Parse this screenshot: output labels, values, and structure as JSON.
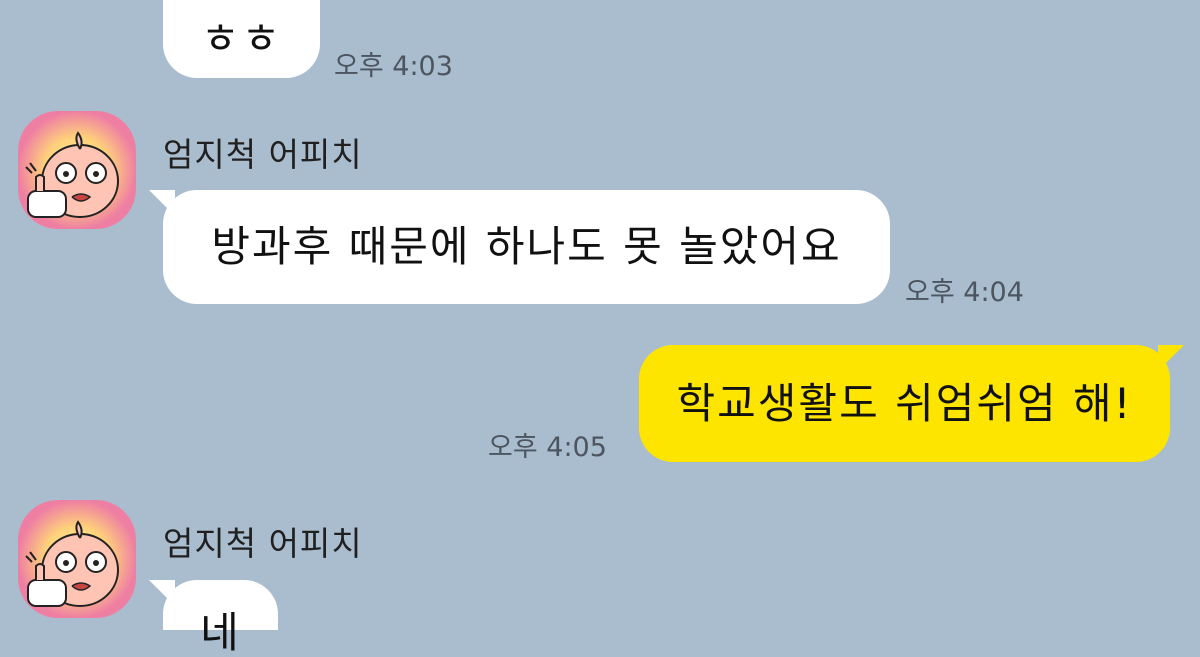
{
  "chat": {
    "background_color": "#a9bdcf",
    "received_bubble_color": "#ffffff",
    "sent_bubble_color": "#fee500",
    "messages": [
      {
        "sender": "",
        "text": "ㅎㅎ",
        "time": "오후 4:03"
      },
      {
        "sender": "엄지척 어피치",
        "text": "방과후 때문에 하나도 못 놀았어요",
        "time": "오후 4:04"
      },
      {
        "sender": "me",
        "text": "학교생활도 쉬엄쉬엄 해!",
        "time": "오후 4:05"
      },
      {
        "sender": "엄지척 어피치",
        "text": "네",
        "time": ""
      }
    ]
  },
  "avatar": {
    "icon": "apeach-thumbs-up-icon"
  }
}
